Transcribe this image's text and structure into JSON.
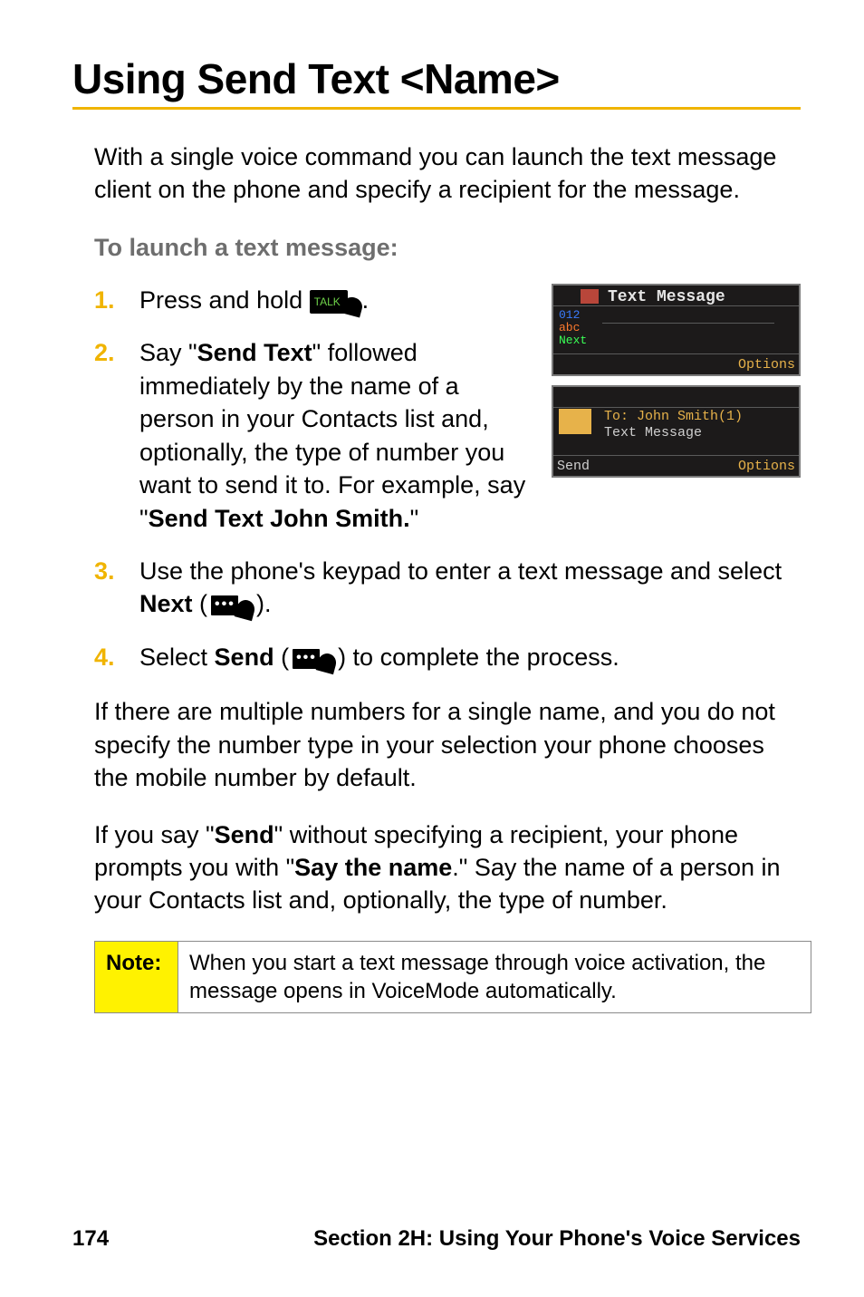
{
  "title": "Using Send Text <Name>",
  "intro": "With a single voice command you can launch the text message client on the phone and specify a recipient for the message.",
  "subhead": "To launch a text message:",
  "steps": {
    "s1": {
      "num": "1.",
      "pre": "Press and hold ",
      "post": "."
    },
    "s2": {
      "num": "2.",
      "t1": "Say \"",
      "b1": "Send Text",
      "t2": "\" followed immediately by the name of a person in your Contacts list and, optionally, the type of number you want to send it to. For example, say \"",
      "b2": "Send Text John Smith.",
      "t3": "\""
    },
    "s3": {
      "num": "3.",
      "t1": "Use the phone's keypad to enter a text message and select ",
      "b1": "Next",
      "t2": " (",
      "t3": ")."
    },
    "s4": {
      "num": "4.",
      "t1": "Select ",
      "b1": "Send",
      "t2": " (",
      "t3": ") to complete the process."
    }
  },
  "after1": {
    "text": "If there are multiple numbers for a single name, and you do not specify the number type in your selection your phone chooses the mobile number by default."
  },
  "after2": {
    "t1": "If you say \"",
    "b1": "Send",
    "t2": "\" without specifying a recipient, your phone prompts you with \"",
    "b2": "Say the name",
    "t3": ".\" Say the name of a person in your Contacts list and, optionally, the type of number."
  },
  "note": {
    "label": "Note:",
    "text": "When you start a text message through voice activation, the message opens in VoiceMode automatically."
  },
  "screens": {
    "s1": {
      "title": "Text Message",
      "left1": "012",
      "left2": "abc",
      "left3": "Next",
      "options": "Options"
    },
    "s2": {
      "to": "To:  John Smith(1)",
      "tm": "Text Message",
      "send": "Send",
      "options": "Options"
    }
  },
  "talk_label": "TALK",
  "dots": "•••",
  "footer": {
    "page": "174",
    "section": "Section 2H: Using Your Phone's Voice Services"
  }
}
